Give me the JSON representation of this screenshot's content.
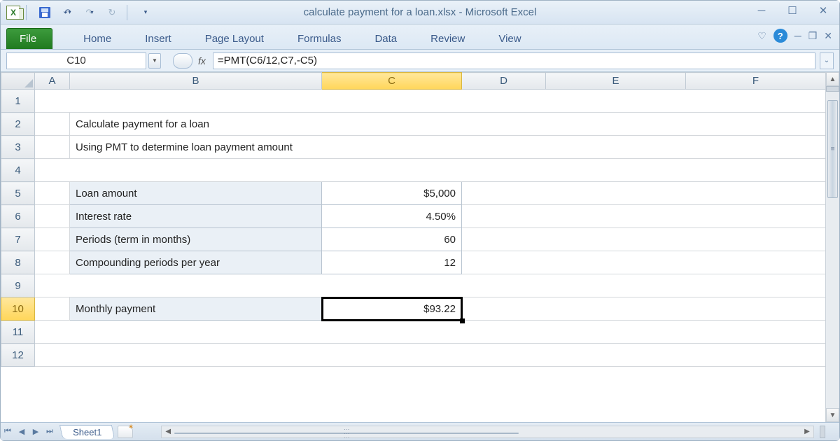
{
  "window": {
    "title": "calculate payment for a loan.xlsx  -  Microsoft Excel"
  },
  "ribbon": {
    "file": "File",
    "tabs": [
      "Home",
      "Insert",
      "Page Layout",
      "Formulas",
      "Data",
      "Review",
      "View"
    ]
  },
  "formula_bar": {
    "name_box": "C10",
    "fx_label": "fx",
    "formula": "=PMT(C6/12,C7,-C5)"
  },
  "columns": [
    "A",
    "B",
    "C",
    "D",
    "E",
    "F"
  ],
  "rows": [
    "1",
    "2",
    "3",
    "4",
    "5",
    "6",
    "7",
    "8",
    "9",
    "10",
    "11",
    "12"
  ],
  "selected": {
    "col": "C",
    "row": "10"
  },
  "content": {
    "title": "Calculate payment for a loan",
    "subtitle": "Using PMT to determine loan payment amount",
    "rows": [
      {
        "label": "Loan amount",
        "value": "$5,000"
      },
      {
        "label": "Interest rate",
        "value": "4.50%"
      },
      {
        "label": "Periods (term in months)",
        "value": "60"
      },
      {
        "label": "Compounding periods per year",
        "value": "12"
      }
    ],
    "result": {
      "label": "Monthly payment",
      "value": "$93.22"
    }
  },
  "sheet_tabs": {
    "active": "Sheet1"
  }
}
